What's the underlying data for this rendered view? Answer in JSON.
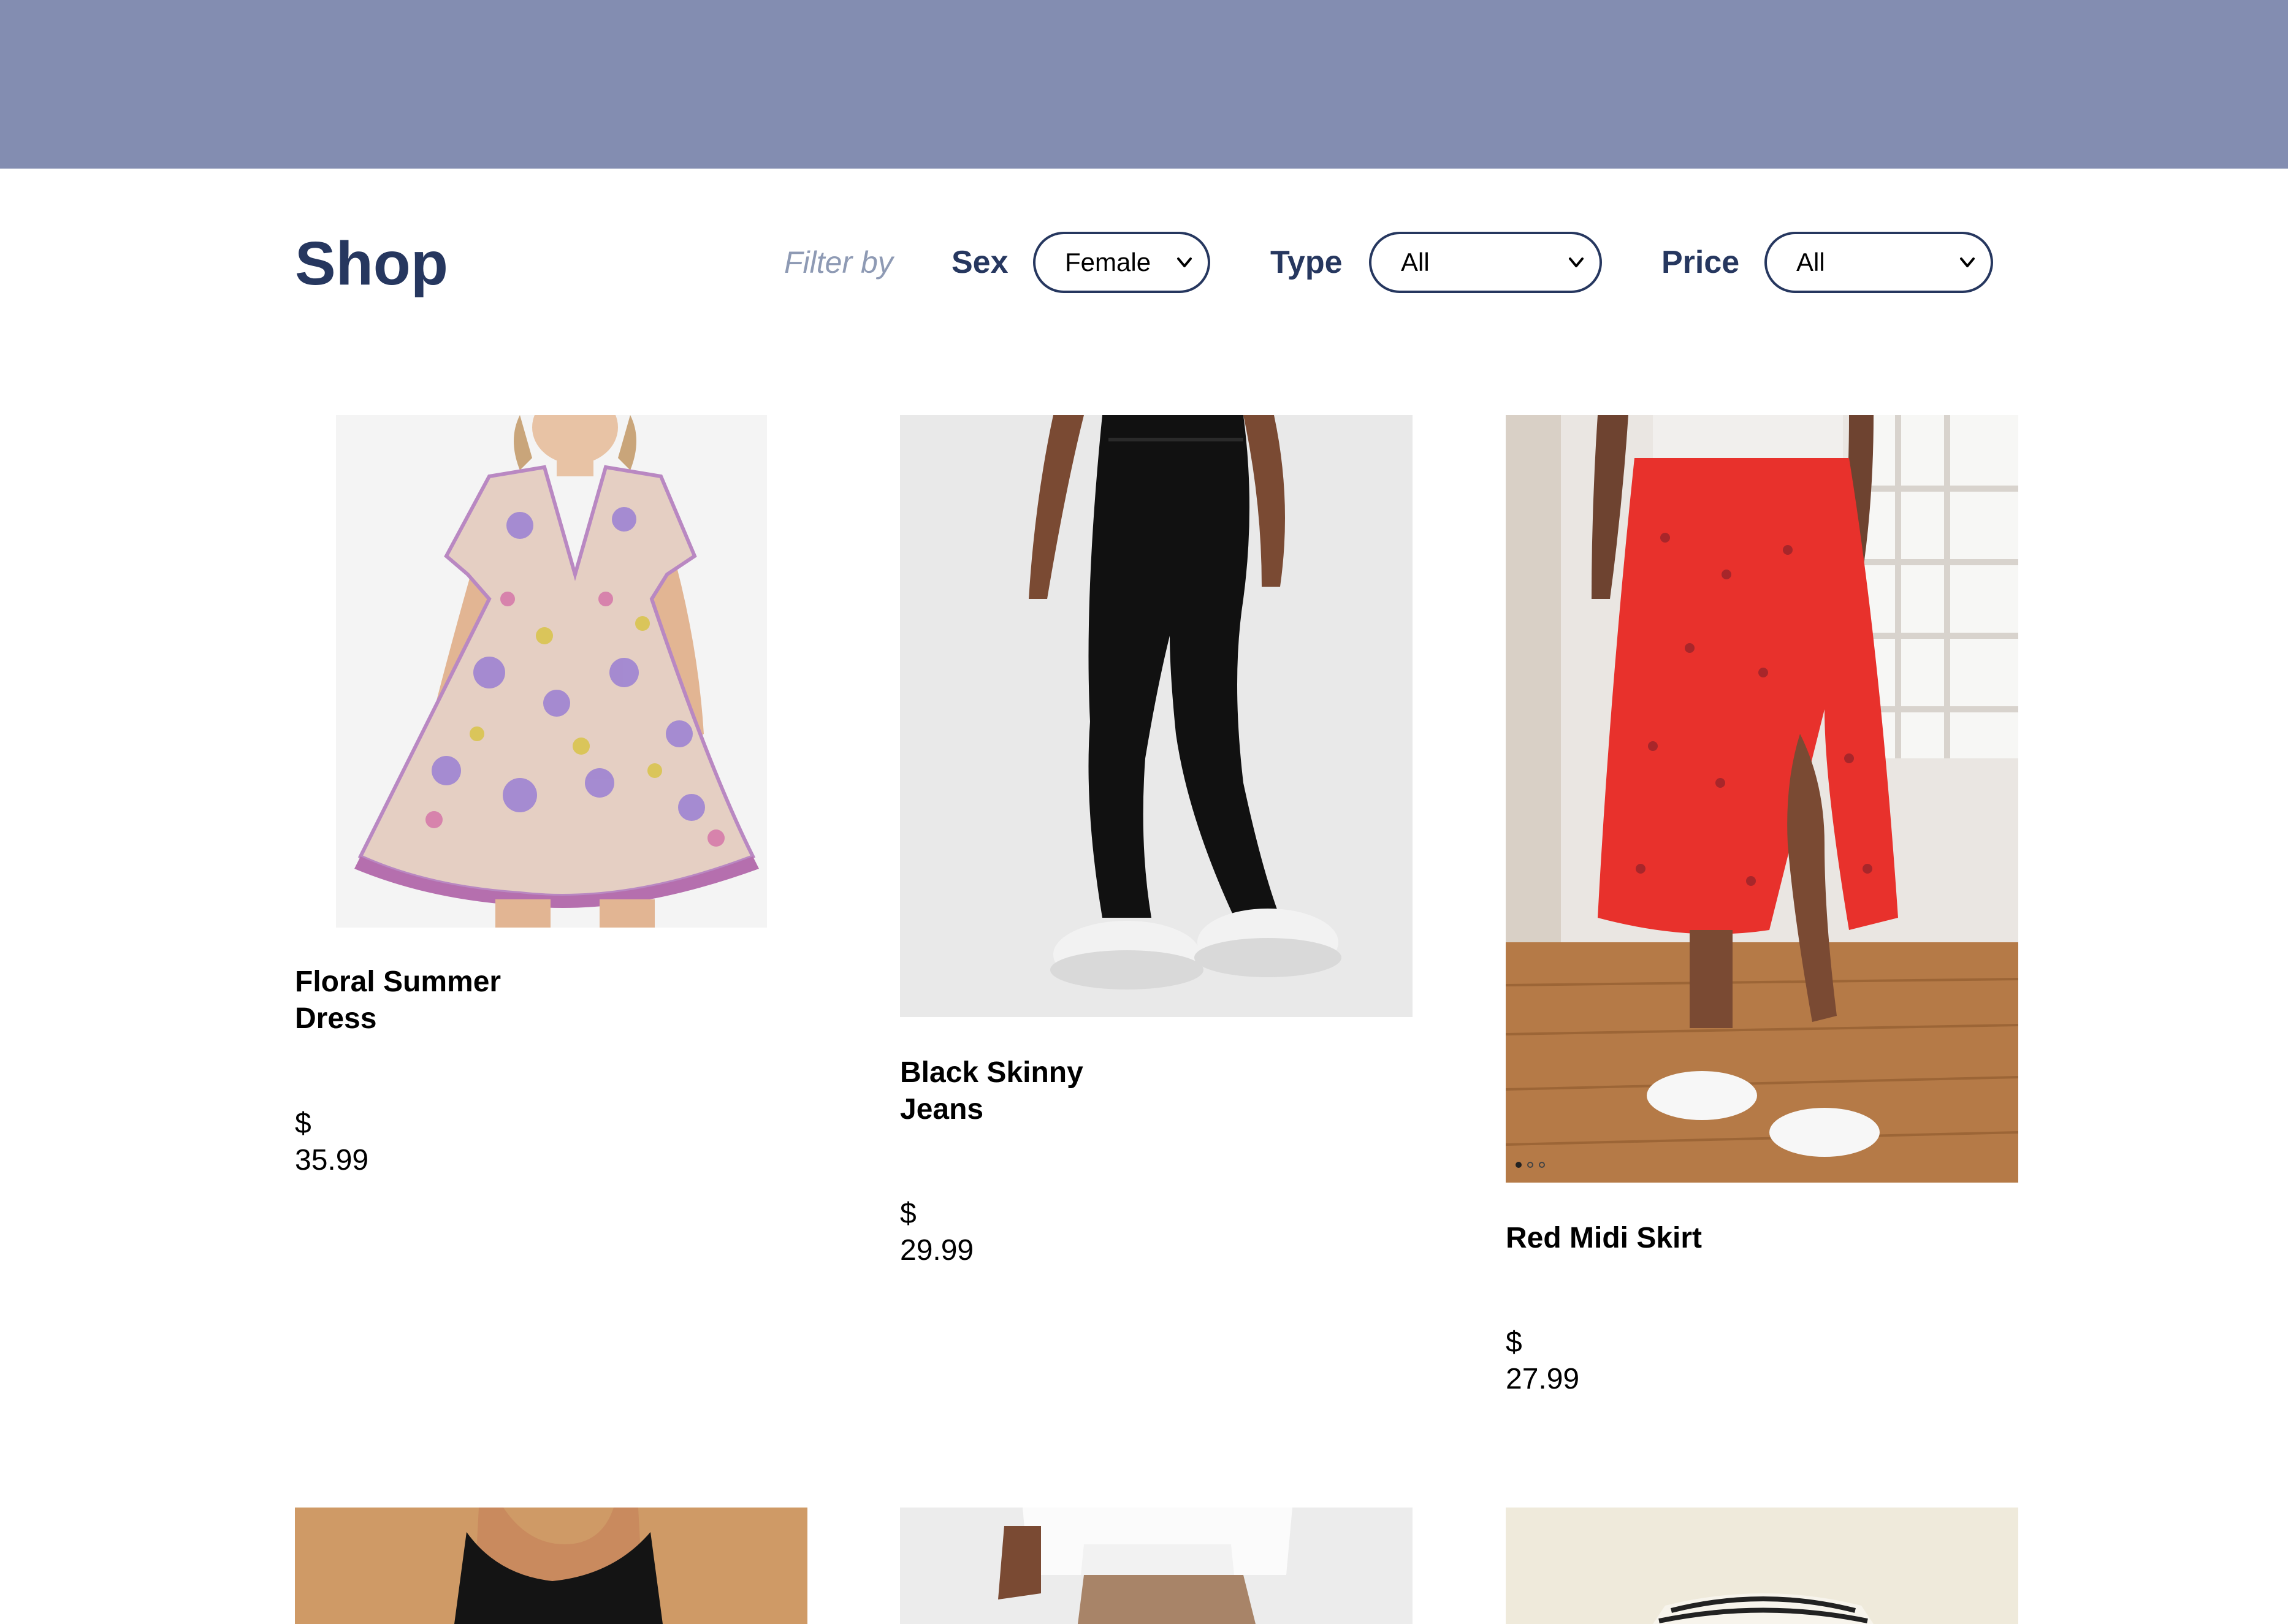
{
  "header": {
    "title": "Shop"
  },
  "filters": {
    "filter_by": "Filter by",
    "sex": {
      "label": "Sex",
      "value": "Female"
    },
    "type": {
      "label": "Type",
      "value": "All"
    },
    "price": {
      "label": "Price",
      "value": "All"
    }
  },
  "products": [
    {
      "name": "Floral Summer Dress",
      "price": "$ 35.99"
    },
    {
      "name": "Black Skinny Jeans",
      "price": "$ 29.99"
    },
    {
      "name": "Red Midi Skirt",
      "price": "$ 27.99"
    }
  ],
  "colors": {
    "banner": "#838db1",
    "brand": "#26375f",
    "muted": "#8e9ab4",
    "skirt": "#e8312c"
  }
}
